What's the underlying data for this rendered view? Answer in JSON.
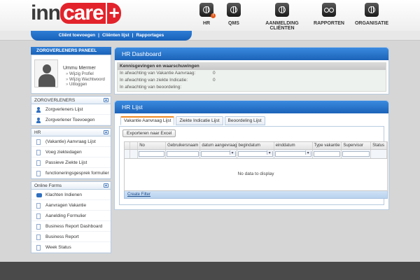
{
  "brand": {
    "logo_inn": "inn",
    "logo_care": "care",
    "logo_plus": "+"
  },
  "topnav": {
    "items": [
      {
        "label": "HR",
        "icon": "globe-icon",
        "badge": "!"
      },
      {
        "label": "QMS",
        "icon": "globe-icon"
      },
      {
        "label": "AANMELDING CLIËNTEN",
        "icon": "globe-icon"
      },
      {
        "label": "RAPPORTEN",
        "icon": "people-icon"
      },
      {
        "label": "ORGANISATIE",
        "icon": "globe-icon"
      }
    ]
  },
  "subnav": {
    "items": [
      "Cliënt toevoegen",
      "Cliënten lijst",
      "Rapportages"
    ],
    "separator": "|"
  },
  "sidebar": {
    "panel_title": "ZORGVERLENERS PANEEL",
    "user": {
      "name": "Ummu Mermer",
      "links": [
        "Wijzig Profiel",
        "Wijzig Wachtwoord",
        "Uitloggen"
      ]
    },
    "sections": [
      {
        "title": "ZORGVERLENERS",
        "items": [
          "Zorgverleners Lijst",
          "Zorgverlener Toevoegen"
        ]
      },
      {
        "title": "HR",
        "items": [
          "(Vakantie) Aanvraag Lijst",
          "Voeg ziektedagen",
          "Passieve Ziekte Lijst",
          "functioneringsgesprek formulier"
        ]
      },
      {
        "title": "Online Forms",
        "items": [
          "Klachten Indienen",
          "Aanvragen Vakantie",
          "Aanelding Formulier",
          "Business Report Dashboard",
          "Business Report",
          "Week Status"
        ]
      }
    ],
    "collapse_glyph": "▲"
  },
  "dashboard": {
    "title": "HR Dashboard",
    "notif_title": "Kennisgevingen en waarschuwingen",
    "rows": [
      {
        "label": "In afwachting van Vakantie Aanvraag:",
        "value": "0"
      },
      {
        "label": "In afwachting van ziekte Indicatie:",
        "value": "0"
      },
      {
        "label": "In afwachting van beoordeling:",
        "value": ""
      }
    ]
  },
  "list": {
    "title": "HR Lijst",
    "tabs": [
      "Vakantie Aanvraag Lijst",
      "Ziekte Indicatie Lijst",
      "Beoordeling Lijst"
    ],
    "export_label": "Exporteren naar Excel",
    "columns": [
      "",
      "",
      "No",
      "Gebruikersnaam",
      "datum aangevraagd",
      "begindatum",
      "einddatum",
      "Type vakantie",
      "Supervisor",
      "Status"
    ],
    "empty_text": "No data to display",
    "filter_link": "Create Filter"
  },
  "colors": {
    "accent": "#1b63b8",
    "brand_red": "#e3232b",
    "tab_highlight": "#f08a24"
  }
}
